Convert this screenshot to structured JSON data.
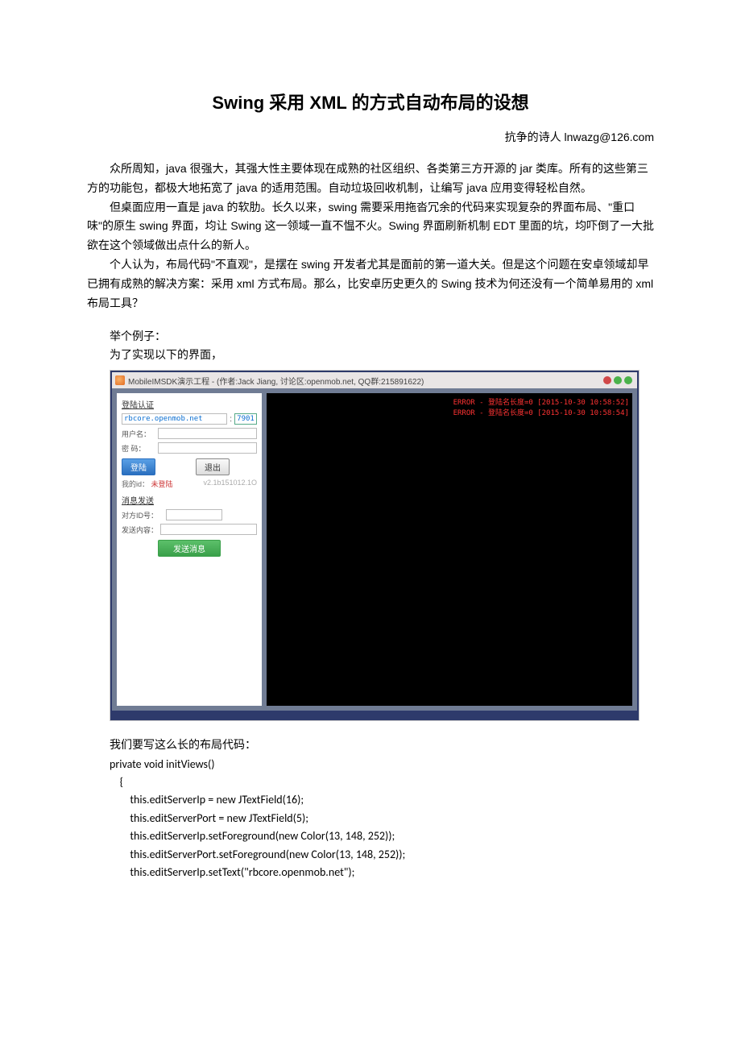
{
  "title": "Swing  采用 XML 的方式自动布局的设想",
  "byline": "抗争的诗人  lnwazg@126.com",
  "para1": "众所周知，java 很强大，其强大性主要体现在成熟的社区组织、各类第三方开源的 jar 类库。所有的这些第三方的功能包，都极大地拓宽了 java 的适用范围。自动垃圾回收机制，让编写 java 应用变得轻松自然。",
  "para2": "但桌面应用一直是 java 的软肋。长久以来，swing 需要采用拖沓冗余的代码来实现复杂的界面布局、\"重口味\"的原生 swing 界面，均让 Swing 这一领域一直不愠不火。Swing 界面刷新机制 EDT 里面的坑，均吓倒了一大批欲在这个领域做出点什么的新人。",
  "para3": "个人认为，布局代码\"不直观\"，是摆在 swing 开发者尤其是面前的第一道大关。但是这个问题在安卓领域却早已拥有成熟的解决方案：采用 xml 方式布局。那么，比安卓历史更久的 Swing 技术为何还没有一个简单易用的 xml 布局工具？",
  "example_intro1": "举个例子：",
  "example_intro2": "为了实现以下的界面，",
  "shot": {
    "titlebar": "MobileIMSDK演示工程 - (作者:Jack Jiang, 讨论区:openmob.net, QQ群:215891622)",
    "sec_login": "登陆认证",
    "server_ip": "rbcore.openmob.net",
    "port_sep": ":",
    "port": "7901",
    "label_user": "用户名：",
    "label_pass": "密   码：",
    "btn_login": "登陆",
    "btn_logout": "退出",
    "id_label": "我的id：",
    "id_value": "未登陆",
    "version": "v2.1b151012.1O",
    "sec_msg": "消息发送",
    "label_target": "对方ID号：",
    "label_content": "发送内容：",
    "btn_send": "发送消息",
    "err1": "ERROR - 登陆名长度=0 [2015-10-30 10:58:52]",
    "err2": "ERROR - 登陆名长度=0 [2015-10-30 10:58:54]"
  },
  "code_intro": "我们要写这么长的布局代码：",
  "code_sig": "private void initViews()",
  "code_body": "    {\n        this.editServerIp = new JTextField(16);\n        this.editServerPort = new JTextField(5);\n        this.editServerIp.setForeground(new Color(13, 148, 252));\n        this.editServerPort.setForeground(new Color(13, 148, 252));\n        this.editServerIp.setText(\"rbcore.openmob.net\");"
}
